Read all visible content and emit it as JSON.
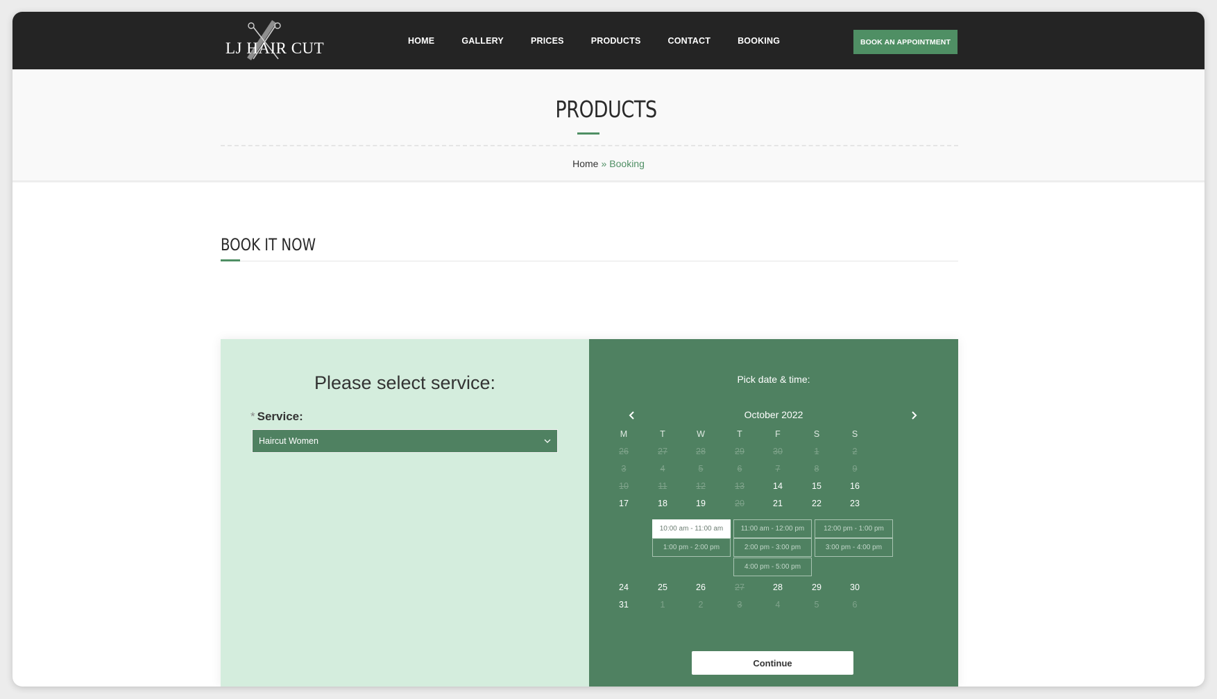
{
  "brand": {
    "logo_text": "LJ HAIR CUT"
  },
  "nav": {
    "items": [
      {
        "label": "HOME"
      },
      {
        "label": "GALLERY"
      },
      {
        "label": "PRICES"
      },
      {
        "label": "PRODUCTS"
      },
      {
        "label": "CONTACT"
      },
      {
        "label": "BOOKING"
      }
    ],
    "cta_label": "BOOK AN APPOINTMENT"
  },
  "title_band": {
    "title": "PRODUCTS",
    "breadcrumb": {
      "home": "Home",
      "separator": "»",
      "current": "Booking"
    }
  },
  "section": {
    "title": "BOOK IT NOW"
  },
  "service_panel": {
    "heading": "Please select service:",
    "required_mark": "*",
    "label": "Service:",
    "selected_service": "Haircut Women"
  },
  "calendar": {
    "label": "Pick date & time:",
    "month": "October 2022",
    "weekdays": [
      "M",
      "T",
      "W",
      "T",
      "F",
      "S",
      "S"
    ],
    "weeks_before_slots": [
      [
        {
          "d": "26",
          "s": "disabled"
        },
        {
          "d": "27",
          "s": "disabled"
        },
        {
          "d": "28",
          "s": "disabled"
        },
        {
          "d": "29",
          "s": "disabled"
        },
        {
          "d": "30",
          "s": "disabled"
        },
        {
          "d": "1",
          "s": "disabled"
        },
        {
          "d": "2",
          "s": "disabled"
        }
      ],
      [
        {
          "d": "3",
          "s": "disabled"
        },
        {
          "d": "4",
          "s": "disabled"
        },
        {
          "d": "5",
          "s": "disabled"
        },
        {
          "d": "6",
          "s": "disabled"
        },
        {
          "d": "7",
          "s": "disabled"
        },
        {
          "d": "8",
          "s": "disabled"
        },
        {
          "d": "9",
          "s": "disabled"
        }
      ],
      [
        {
          "d": "10",
          "s": "disabled"
        },
        {
          "d": "11",
          "s": "disabled"
        },
        {
          "d": "12",
          "s": "disabled"
        },
        {
          "d": "13",
          "s": "disabled"
        },
        {
          "d": "14",
          "s": "available"
        },
        {
          "d": "15",
          "s": "available"
        },
        {
          "d": "16",
          "s": "available"
        }
      ],
      [
        {
          "d": "17",
          "s": "available"
        },
        {
          "d": "18",
          "s": "available"
        },
        {
          "d": "19",
          "s": "available"
        },
        {
          "d": "20",
          "s": "disabled"
        },
        {
          "d": "21",
          "s": "available"
        },
        {
          "d": "22",
          "s": "available"
        },
        {
          "d": "23",
          "s": "available"
        }
      ]
    ],
    "time_slots": [
      {
        "label": "10:00 am - 11:00 am",
        "selected": true
      },
      {
        "label": "11:00 am - 12:00 pm",
        "selected": false
      },
      {
        "label": "12:00 pm - 1:00 pm",
        "selected": false
      },
      {
        "label": "1:00 pm - 2:00 pm",
        "selected": false
      },
      {
        "label": "2:00 pm - 3:00 pm",
        "selected": false
      },
      {
        "label": "3:00 pm - 4:00 pm",
        "selected": false
      },
      {
        "label": "4:00 pm - 5:00 pm",
        "selected": false
      }
    ],
    "weeks_after_slots": [
      [
        {
          "d": "24",
          "s": "available"
        },
        {
          "d": "25",
          "s": "available"
        },
        {
          "d": "26",
          "s": "available"
        },
        {
          "d": "27",
          "s": "disabled"
        },
        {
          "d": "28",
          "s": "available"
        },
        {
          "d": "29",
          "s": "available"
        },
        {
          "d": "30",
          "s": "available"
        }
      ],
      [
        {
          "d": "31",
          "s": "available"
        },
        {
          "d": "1",
          "s": "muted"
        },
        {
          "d": "2",
          "s": "muted"
        },
        {
          "d": "3",
          "s": "disabled"
        },
        {
          "d": "4",
          "s": "muted"
        },
        {
          "d": "5",
          "s": "muted"
        },
        {
          "d": "6",
          "s": "muted"
        }
      ]
    ],
    "continue_label": "Continue"
  },
  "colors": {
    "brand_green": "#4f8f64",
    "panel_green": "#4f8161",
    "panel_mint": "#d4eddd",
    "header_dark": "#242424"
  }
}
